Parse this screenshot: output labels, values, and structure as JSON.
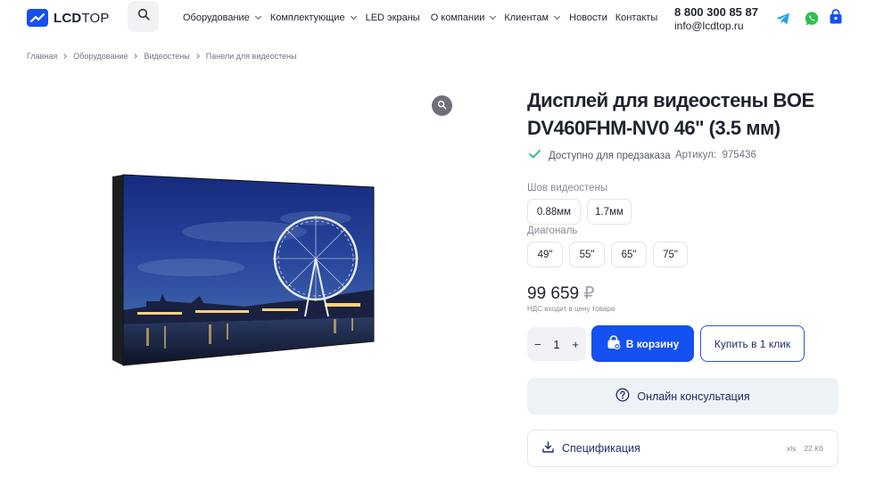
{
  "header": {
    "logo": {
      "bold": "LCD",
      "light": "TOP"
    },
    "nav": [
      {
        "label": "Оборудование",
        "has_menu": true
      },
      {
        "label": "Комплектующие",
        "has_menu": true
      },
      {
        "label": "LED экраны",
        "has_menu": false
      },
      {
        "label": "О компании",
        "has_menu": true
      },
      {
        "label": "Клиентам",
        "has_menu": true
      },
      {
        "label": "Новости",
        "has_menu": false
      },
      {
        "label": "Контакты",
        "has_menu": false
      }
    ],
    "phone": "8 800 300 85 87",
    "email": "info@lcdtop.ru",
    "icons": [
      "search-icon",
      "telegram-icon",
      "whatsapp-icon",
      "bag-icon"
    ]
  },
  "breadcrumb": [
    "Главная",
    "Оборудование",
    "Видеостены",
    "Панели для видеостены"
  ],
  "product": {
    "title_line1": "Дисплей для видеостены BOE",
    "title_line2": "DV460FHM-NV0 46\" (3.5 мм)",
    "availability": "Доступно для предзаказа",
    "sku_label": "Артикул:",
    "sku": "975436",
    "seam_label": "Шов видеостены",
    "seam_options": [
      "0.88мм",
      "1.7мм"
    ],
    "diagonal_label": "Диагональ",
    "diagonal_options": [
      "49\"",
      "55\"",
      "65\"",
      "75\""
    ],
    "price": "99 659",
    "currency": "₽",
    "vat_note": "НДС входит в цену товара",
    "quantity": "1",
    "qty_minus": "−",
    "qty_plus": "+",
    "cart_button": "В корзину",
    "one_click_button": "Купить в 1 клик",
    "consult_button": "Онлайн консультация",
    "spec": {
      "label": "Спецификация",
      "ext": "xls",
      "size": "22 Кб"
    }
  },
  "colors": {
    "accent": "#1550f0",
    "check": "#2bb673",
    "telegram": "#2aa3df",
    "whatsapp": "#2fbf4f"
  }
}
